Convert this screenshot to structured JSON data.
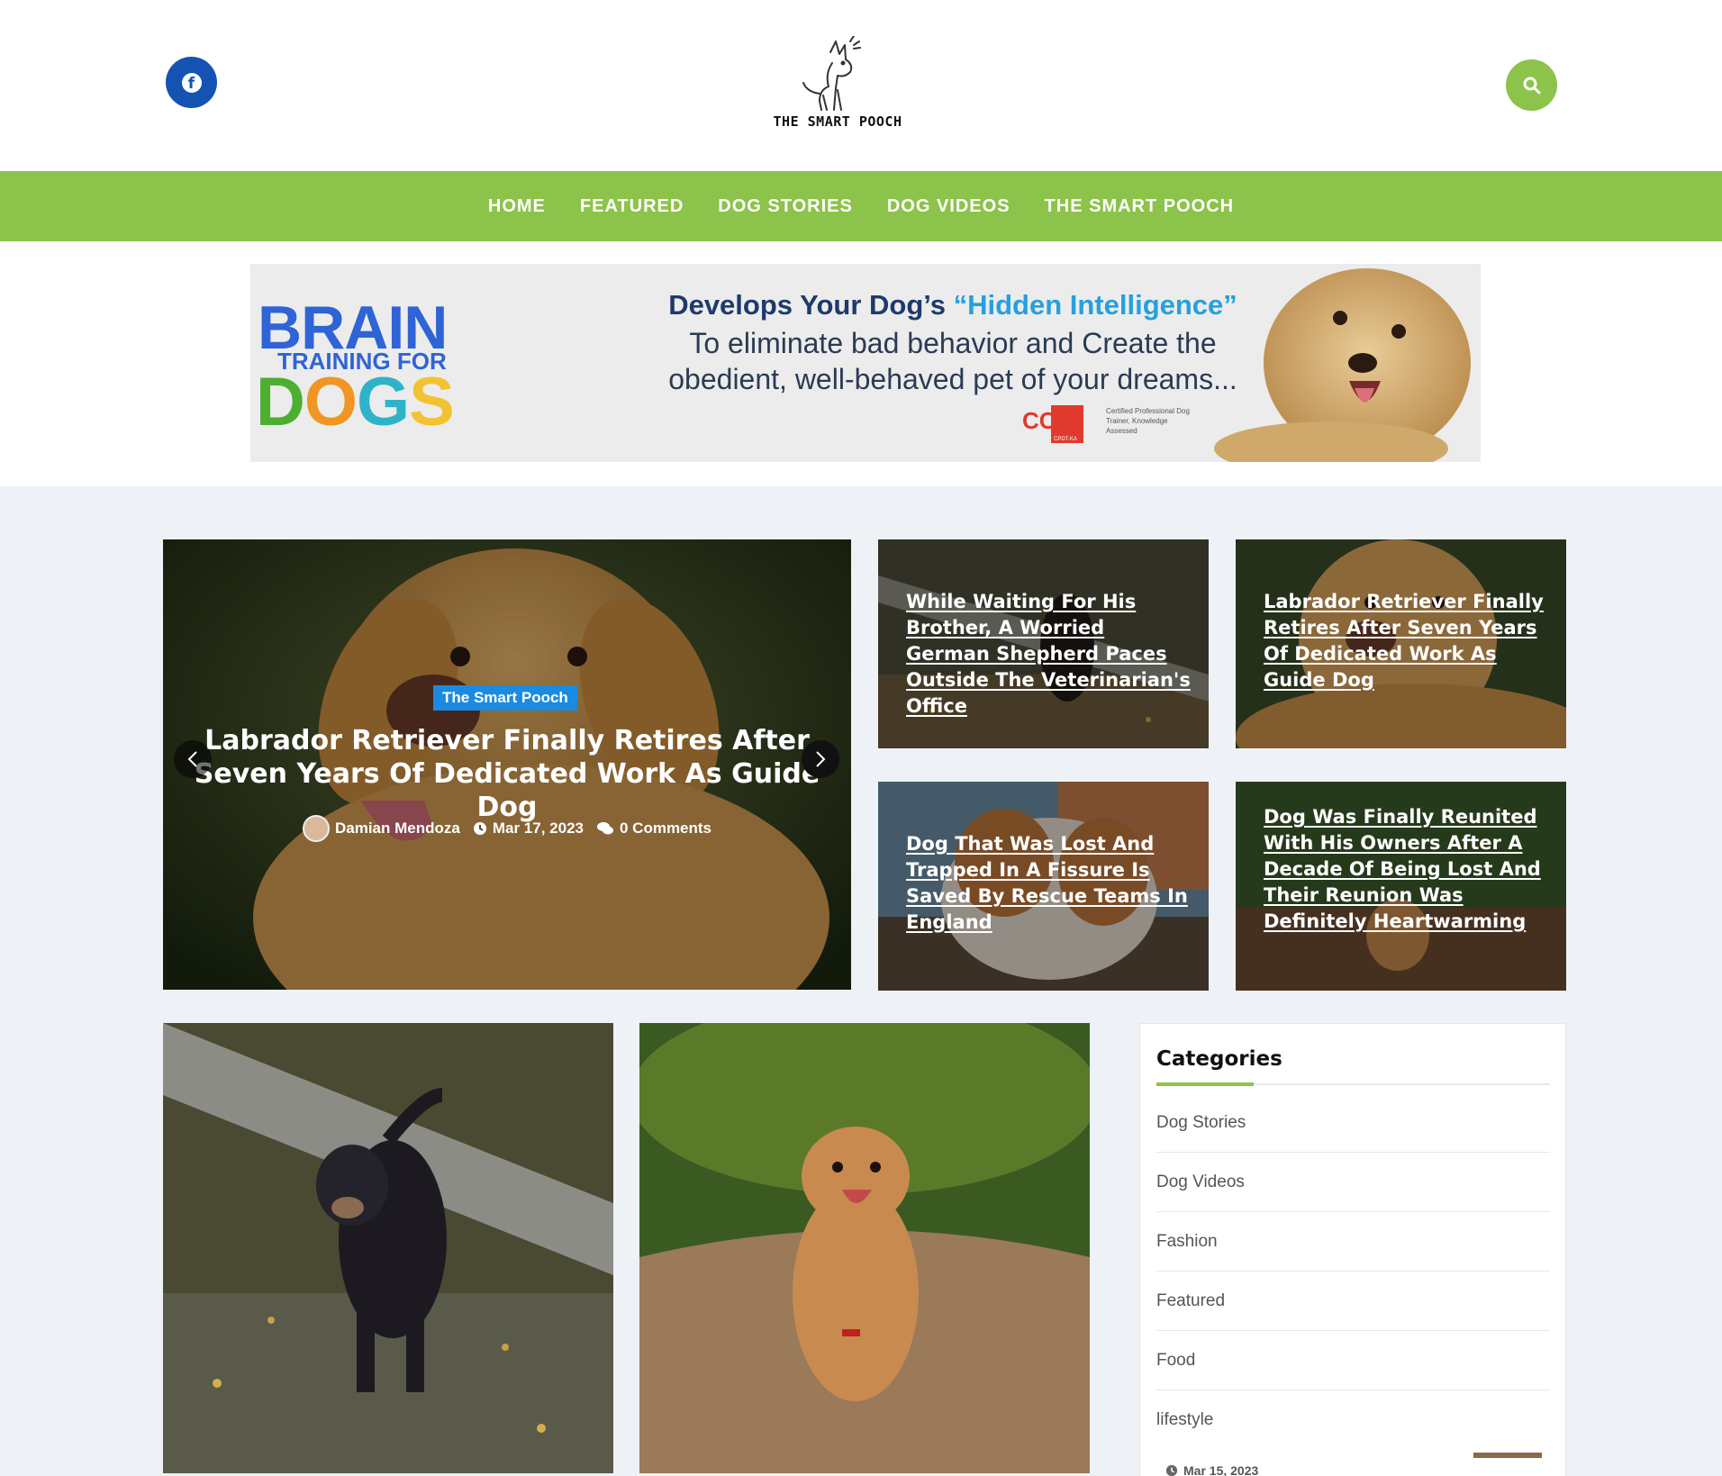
{
  "header": {
    "logo_text": "THE SMART POOCH",
    "social": {
      "icon": "facebook-icon",
      "glyph": "f"
    },
    "search": {
      "icon": "search-icon"
    }
  },
  "nav": {
    "items": [
      {
        "label": "HOME"
      },
      {
        "label": "FEATURED"
      },
      {
        "label": "DOG STORIES"
      },
      {
        "label": "DOG VIDEOS"
      },
      {
        "label": "THE SMART POOCH"
      }
    ]
  },
  "ad": {
    "brand_line1": "BRAIN",
    "brand_line2": "TRAINING FOR",
    "brand_dogs": [
      "D",
      "O",
      "G",
      "S"
    ],
    "headline_prefix": "Develops Your Dog’s ",
    "headline_highlight": "“Hidden Intelligence”",
    "sub_line1": "To eliminate bad behavior and Create the",
    "sub_line2": "obedient, well-behaved pet of your dreams...",
    "cert_logo": "CCPDT",
    "cert_small": "CPDT-KA",
    "cert_text": "Certified Professional Dog Trainer, Knowledge Assessed"
  },
  "slider": {
    "category": "The Smart Pooch",
    "title": "Labrador Retriever Finally Retires After Seven Years Of Dedicated Work As Guide Dog",
    "author": "Damian Mendoza",
    "date": "Mar 17, 2023",
    "comments": "0 Comments",
    "prev_icon": "chevron-left-icon",
    "next_icon": "chevron-right-icon"
  },
  "tiles": [
    {
      "title": "While Waiting For His Brother, A Worried German Shepherd Paces Outside The Veterinarian's Office"
    },
    {
      "title": "Labrador Retriever Finally Retires After Seven Years Of Dedicated Work As Guide Dog"
    },
    {
      "title": "Dog That Was Lost And Trapped In A Fissure Is Saved By Rescue Teams In England"
    },
    {
      "title": "Dog Was Finally Reunited With His Owners After A Decade Of Being Lost And Their Reunion Was Definitely Heartwarming"
    }
  ],
  "sidebar": {
    "title": "Categories",
    "items": [
      {
        "label": "Dog Stories"
      },
      {
        "label": "Dog Videos"
      },
      {
        "label": "Fashion"
      },
      {
        "label": "Featured"
      },
      {
        "label": "Food"
      },
      {
        "label": "lifestyle"
      }
    ],
    "partial_date": "Mar 15, 2023"
  },
  "colors": {
    "brand_green": "#8cc34a",
    "facebook_blue": "#1553b3",
    "badge_blue": "#1a8be0"
  }
}
